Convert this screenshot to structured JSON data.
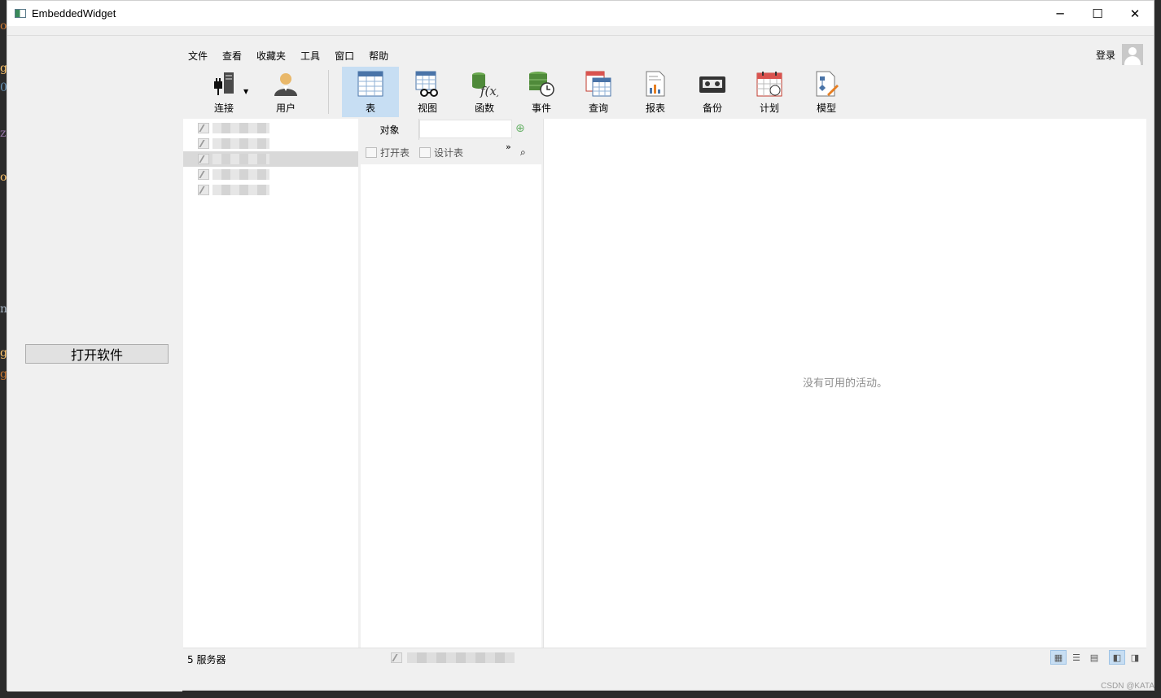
{
  "window": {
    "title": "EmbeddedWidget",
    "controls": {
      "minimize": "─",
      "maximize": "☐",
      "close": "✕"
    }
  },
  "launcher": {
    "open_label": "打开软件"
  },
  "menubar": {
    "items": [
      "文件",
      "查看",
      "收藏夹",
      "工具",
      "窗口",
      "帮助"
    ]
  },
  "account": {
    "login_label": "登录"
  },
  "toolbar": {
    "connect": "连接",
    "user": "用户",
    "tools": [
      {
        "label": "表",
        "icon": "table-icon",
        "active": true
      },
      {
        "label": "视图",
        "icon": "view-icon"
      },
      {
        "label": "函数",
        "icon": "function-icon"
      },
      {
        "label": "事件",
        "icon": "event-icon"
      },
      {
        "label": "查询",
        "icon": "query-icon"
      },
      {
        "label": "报表",
        "icon": "report-icon"
      },
      {
        "label": "备份",
        "icon": "backup-icon"
      },
      {
        "label": "计划",
        "icon": "schedule-icon"
      },
      {
        "label": "模型",
        "icon": "model-icon"
      }
    ]
  },
  "objects": {
    "tab_label": "对象",
    "search_value": "",
    "open_table": "打开表",
    "design_table": "设计表",
    "more": "»",
    "find_icon": "⌕"
  },
  "activity": {
    "empty_text": "没有可用的活动。"
  },
  "status": {
    "server_count": "5 服务器"
  },
  "colors": {
    "active_tool": "#c7def3",
    "panel_bg": "#f0f0f0"
  },
  "watermark": "CSDN @KATA"
}
